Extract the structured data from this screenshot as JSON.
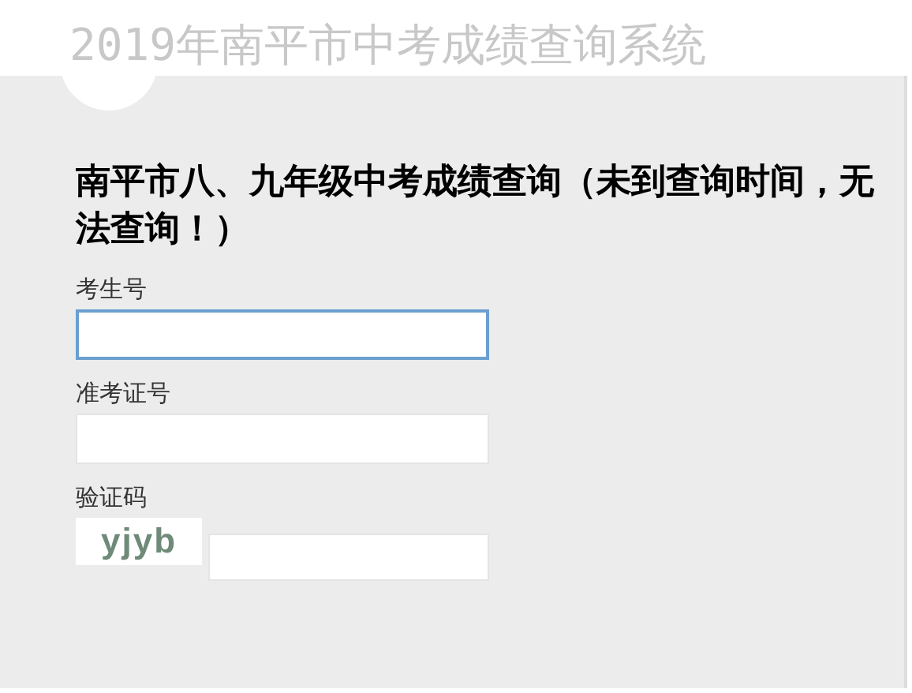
{
  "page_title": "2019年南平市中考成绩查询系统",
  "form": {
    "heading": "南平市八、九年级中考成绩查询（未到查询时间，无法查询！）",
    "fields": [
      {
        "kind": "text",
        "label": "考生号",
        "focused": true
      },
      {
        "kind": "text",
        "label": "准考证号",
        "focused": false
      },
      {
        "kind": "captcha",
        "label": "验证码",
        "captcha": "yjyb",
        "focused": false
      }
    ]
  }
}
